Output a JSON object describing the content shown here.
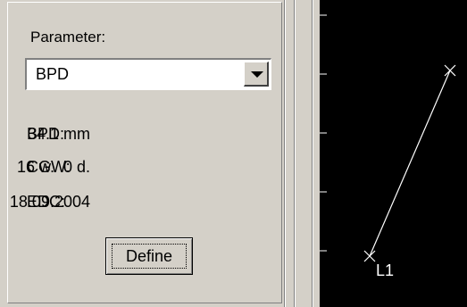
{
  "parameter": {
    "label": "Parameter:",
    "selected": "BPD"
  },
  "measurements": [
    {
      "label": "BPD:",
      "value": "34.1 mm"
    },
    {
      "label": "CGW:",
      "value": "16 w.  0 d."
    },
    {
      "label": "EDC:",
      "value": "18.09.2004"
    }
  ],
  "buttons": {
    "define_label": "Define"
  },
  "canvas": {
    "line_label": "L1",
    "background": "#000000",
    "stroke": "#ffffff"
  }
}
